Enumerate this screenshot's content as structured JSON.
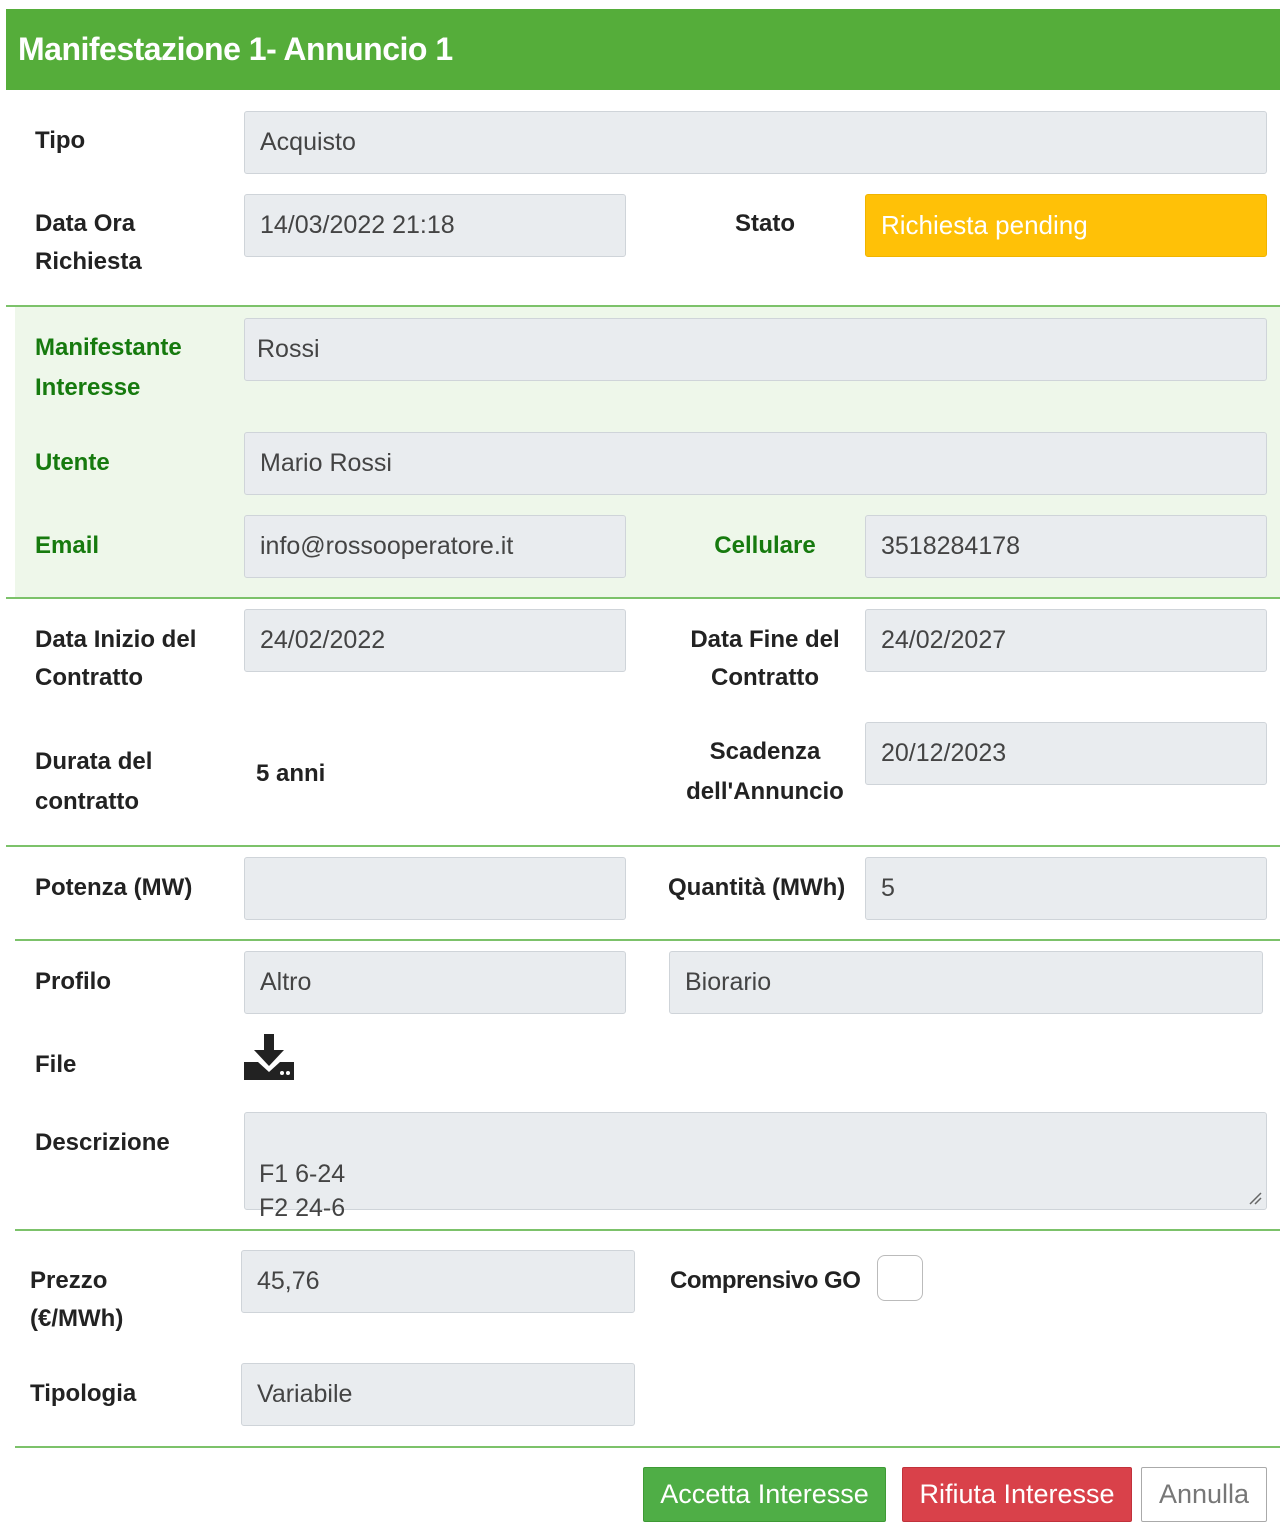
{
  "header": {
    "title": "Manifestazione 1- Annuncio 1"
  },
  "colors": {
    "header_bg": "#55ad3a",
    "status_bg": "#ffc107",
    "accept": "#4fae46",
    "reject": "#d9414a",
    "section_label": "#167a0e"
  },
  "tipo": {
    "label": "Tipo",
    "value": "Acquisto"
  },
  "data_ora": {
    "label_line1": "Data Ora",
    "label_line2": "Richiesta",
    "value": "14/03/2022 21:18"
  },
  "stato": {
    "label": "Stato",
    "value": "Richiesta pending"
  },
  "manifestante": {
    "label_line1": "Manifestante",
    "label_line2": "Interesse",
    "value": "Rossi"
  },
  "utente": {
    "label": "Utente",
    "value": "Mario Rossi"
  },
  "email": {
    "label": "Email",
    "value": "info@rossooperatore.it"
  },
  "cellulare": {
    "label": "Cellulare",
    "value": "3518284178"
  },
  "data_inizio": {
    "label_line1": "Data Inizio del",
    "label_line2": "Contratto",
    "value": "24/02/2022"
  },
  "data_fine": {
    "label_line1": "Data Fine del",
    "label_line2": "Contratto",
    "value": "24/02/2027"
  },
  "durata": {
    "label_line1": "Durata del",
    "label_line2": "contratto",
    "value": "5 anni"
  },
  "scadenza": {
    "label_line1": "Scadenza",
    "label_line2": "dell'Annuncio",
    "value": "20/12/2023"
  },
  "potenza": {
    "label": "Potenza (MW)",
    "value": ""
  },
  "quantita": {
    "label": "Quantità (MWh)",
    "value": "5"
  },
  "profilo": {
    "label": "Profilo",
    "value1": "Altro",
    "value2": "Biorario"
  },
  "file": {
    "label": "File",
    "icon": "download-icon"
  },
  "descrizione": {
    "label": "Descrizione",
    "value": "F1 6-24\nF2 24-6"
  },
  "prezzo": {
    "label_line1": "Prezzo",
    "label_line2": "(€/MWh)",
    "value": "45,76"
  },
  "comprensivo": {
    "label": "Comprensivo GO",
    "checked": false
  },
  "tipologia": {
    "label": "Tipologia",
    "value": "Variabile"
  },
  "actions": {
    "accept": "Accetta Interesse",
    "reject": "Rifiuta Interesse",
    "cancel": "Annulla"
  }
}
